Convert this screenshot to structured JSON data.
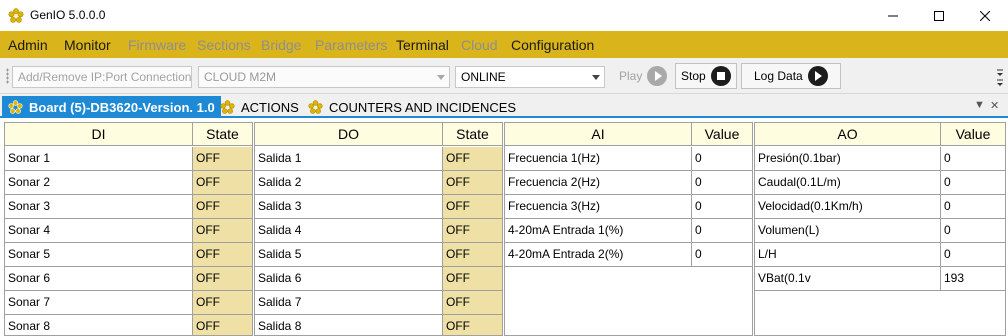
{
  "window": {
    "title": "GenIO 5.0.0.0"
  },
  "menu": [
    {
      "label": "Admin",
      "enabled": true
    },
    {
      "label": "Monitor",
      "enabled": true
    },
    {
      "label": "Firmware",
      "enabled": false
    },
    {
      "label": "Sections",
      "enabled": false
    },
    {
      "label": "Bridge",
      "enabled": false
    },
    {
      "label": "Parameters",
      "enabled": false
    },
    {
      "label": "Terminal",
      "enabled": true
    },
    {
      "label": "Cloud",
      "enabled": false
    },
    {
      "label": "Configuration",
      "enabled": true
    }
  ],
  "toolbar": {
    "connection_placeholder": "Add/Remove IP:Port Connection",
    "cloud_combo": "CLOUD M2M",
    "status_combo": "ONLINE",
    "play_label": "Play",
    "stop_label": "Stop",
    "log_label": "Log Data"
  },
  "tabs": [
    {
      "label": "Board (5)-DB3620-Version. 1.0",
      "active": true
    },
    {
      "label": "ACTIONS",
      "active": false
    },
    {
      "label": "COUNTERS AND INCIDENCES",
      "active": false
    }
  ],
  "tab_controls": {
    "dropdown": "▼",
    "close": "✕"
  },
  "tables": {
    "di": {
      "headers": [
        "DI",
        "State"
      ],
      "rows": [
        [
          "Sonar 1",
          "OFF"
        ],
        [
          "Sonar 2",
          "OFF"
        ],
        [
          "Sonar 3",
          "OFF"
        ],
        [
          "Sonar 4",
          "OFF"
        ],
        [
          "Sonar 5",
          "OFF"
        ],
        [
          "Sonar 6",
          "OFF"
        ],
        [
          "Sonar 7",
          "OFF"
        ],
        [
          "Sonar 8",
          "OFF"
        ]
      ]
    },
    "do": {
      "headers": [
        "DO",
        "State"
      ],
      "rows": [
        [
          "Salida 1",
          "OFF"
        ],
        [
          "Salida 2",
          "OFF"
        ],
        [
          "Salida 3",
          "OFF"
        ],
        [
          "Salida 4",
          "OFF"
        ],
        [
          "Salida 5",
          "OFF"
        ],
        [
          "Salida 6",
          "OFF"
        ],
        [
          "Salida 7",
          "OFF"
        ],
        [
          "Salida 8",
          "OFF"
        ]
      ]
    },
    "ai": {
      "headers": [
        "AI",
        "Value"
      ],
      "rows": [
        [
          "Frecuencia 1(Hz)",
          "0"
        ],
        [
          "Frecuencia 2(Hz)",
          "0"
        ],
        [
          "Frecuencia 3(Hz)",
          "0"
        ],
        [
          "4-20mA Entrada 1(%)",
          "0"
        ],
        [
          "4-20mA Entrada 2(%)",
          "0"
        ]
      ]
    },
    "ao": {
      "headers": [
        "AO",
        "Value"
      ],
      "rows": [
        [
          "Presión(0.1bar)",
          "0"
        ],
        [
          "Caudal(0.1L/m)",
          "0"
        ],
        [
          "Velocidad(0.1Km/h)",
          "0"
        ],
        [
          "Volumen(L)",
          "0"
        ],
        [
          "L/H",
          "0"
        ],
        [
          "VBat(0.1v",
          "193"
        ]
      ]
    }
  },
  "colors": {
    "menu_bar": "#d9b41a",
    "tab_active": "#1e8ad6",
    "table_header": "#fffde0",
    "state_cell": "#efe0a6"
  },
  "icons": {
    "app": "gear-flower-icon",
    "minimize": "minimize-icon",
    "maximize": "maximize-icon",
    "close": "close-icon",
    "play": "play-icon",
    "stop": "stop-icon"
  }
}
